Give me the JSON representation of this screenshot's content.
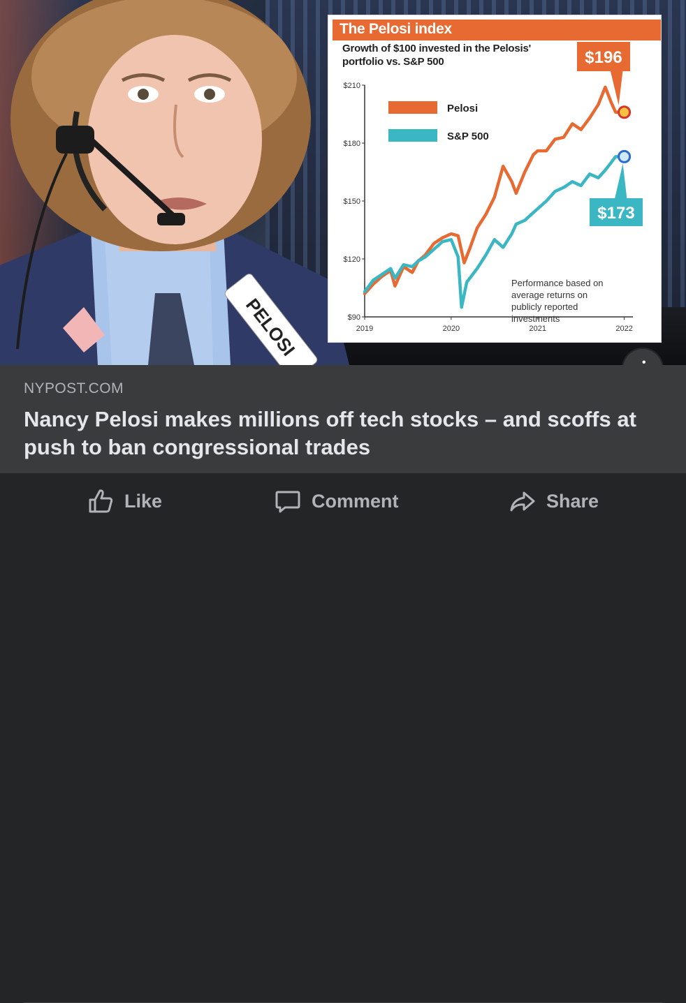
{
  "link_card": {
    "domain": "NYPOST.COM",
    "headline": "Nancy Pelosi makes millions off tech stocks – and scoffs at push to ban congressional trades",
    "info_icon": "i",
    "badge_text": "PELOSI"
  },
  "graphic": {
    "title": "The Pelosi index",
    "subtitle": "Growth of $100 invested in the Pelosis' portfolio vs. S&P 500",
    "note": "Performance based on average returns on publicly reported investments",
    "callout_pelosi": "$196",
    "callout_sp500": "$173",
    "accent_color": "#e86a33",
    "sp500_color": "#3bb7c4"
  },
  "chart_data": {
    "type": "line",
    "title": "The Pelosi index",
    "subtitle": "Growth of $100 invested in the Pelosis' portfolio vs. S&P 500",
    "x_ticks": [
      "2019",
      "2020",
      "2021",
      "2022"
    ],
    "y_ticks": [
      "$90",
      "$120",
      "$150",
      "$180",
      "$210"
    ],
    "ylim": [
      90,
      210
    ],
    "xlim": [
      2019,
      2022.1
    ],
    "legend_position": "top-left",
    "series": [
      {
        "name": "Pelosi",
        "color": "#e86a33",
        "x": [
          2019.0,
          2019.1,
          2019.2,
          2019.3,
          2019.35,
          2019.45,
          2019.55,
          2019.62,
          2019.7,
          2019.8,
          2019.9,
          2020.0,
          2020.08,
          2020.15,
          2020.22,
          2020.3,
          2020.4,
          2020.5,
          2020.6,
          2020.7,
          2020.75,
          2020.85,
          2020.95,
          2021.0,
          2021.1,
          2021.2,
          2021.3,
          2021.4,
          2021.5,
          2021.6,
          2021.7,
          2021.78,
          2021.85,
          2021.9,
          2022.0
        ],
        "y": [
          102,
          107,
          111,
          114,
          106,
          116,
          113,
          119,
          122,
          128,
          131,
          133,
          132,
          118,
          126,
          136,
          143,
          152,
          168,
          160,
          154,
          165,
          174,
          176,
          176,
          182,
          183,
          190,
          187,
          193,
          200,
          209,
          201,
          196,
          196
        ]
      },
      {
        "name": "S&P 500",
        "color": "#3bb7c4",
        "x": [
          2019.0,
          2019.1,
          2019.2,
          2019.3,
          2019.35,
          2019.45,
          2019.55,
          2019.62,
          2019.7,
          2019.8,
          2019.9,
          2020.0,
          2020.08,
          2020.12,
          2020.18,
          2020.3,
          2020.4,
          2020.5,
          2020.6,
          2020.7,
          2020.75,
          2020.85,
          2020.95,
          2021.0,
          2021.1,
          2021.2,
          2021.3,
          2021.4,
          2021.5,
          2021.6,
          2021.7,
          2021.78,
          2021.85,
          2021.9,
          2022.0
        ],
        "y": [
          103,
          109,
          112,
          115,
          110,
          117,
          116,
          119,
          121,
          125,
          129,
          130,
          121,
          95,
          108,
          115,
          122,
          130,
          126,
          133,
          138,
          140,
          144,
          146,
          150,
          155,
          157,
          160,
          158,
          164,
          162,
          166,
          170,
          173,
          173
        ]
      }
    ],
    "end_values": {
      "Pelosi": 196,
      "S&P 500": 173
    }
  },
  "actions": {
    "like_label": "Like",
    "comment_label": "Comment",
    "share_label": "Share"
  },
  "icons": {
    "like": "thumbs-up-icon",
    "comment": "comment-bubble-icon",
    "share": "share-arrow-icon",
    "info": "info-icon"
  }
}
